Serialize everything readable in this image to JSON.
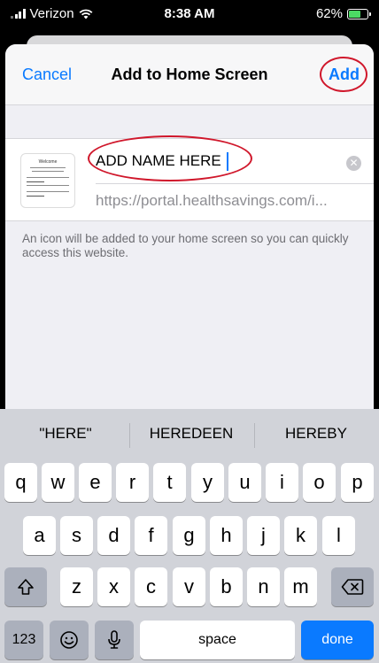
{
  "status": {
    "carrier": "Verizon",
    "time": "8:38 AM",
    "battery": "62%",
    "battery_level": 0.62
  },
  "sheet": {
    "cancel_label": "Cancel",
    "title": "Add to Home Screen",
    "add_label": "Add"
  },
  "form": {
    "thumb_title": "Welcome",
    "name_value": "ADD NAME HERE",
    "url": "https://portal.healthsavings.com/i..."
  },
  "info": "An icon will be added to your home screen so you can quickly access this website.",
  "keyboard": {
    "suggestions": [
      "\"HERE\"",
      "HEREDEEN",
      "HEREBY"
    ],
    "row1": [
      "q",
      "w",
      "e",
      "r",
      "t",
      "y",
      "u",
      "i",
      "o",
      "p"
    ],
    "row2": [
      "a",
      "s",
      "d",
      "f",
      "g",
      "h",
      "j",
      "k",
      "l"
    ],
    "row3": [
      "z",
      "x",
      "c",
      "v",
      "b",
      "n",
      "m"
    ],
    "numbers_label": "123",
    "space_label": "space",
    "done_label": "done"
  },
  "colors": {
    "accent": "#0a7aff",
    "annotation_ring": "#d0172b",
    "battery_fill": "#4cd964"
  }
}
